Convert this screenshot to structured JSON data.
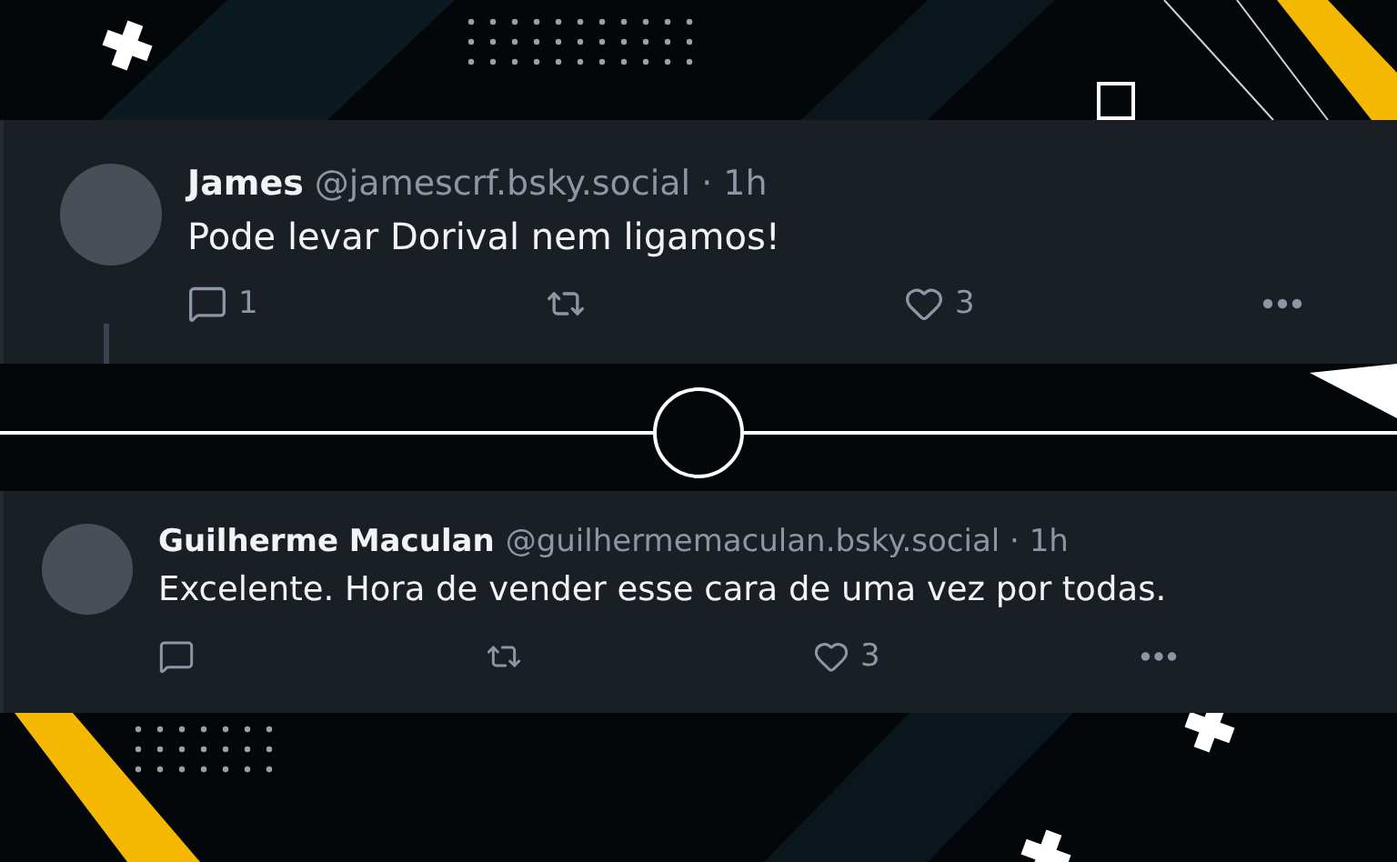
{
  "posts": [
    {
      "author": "James",
      "meta": "@jamescrf.bsky.social · 1h",
      "text": "Pode levar Dorival nem ligamos!",
      "replies": "1",
      "likes": "3",
      "thread_line": true
    },
    {
      "author": "Guilherme Maculan",
      "meta": "@guilhermemaculan.bsky.social · 1h",
      "text": "Excelente. Hora de vender esse cara de uma vez por todas.",
      "likes": "3",
      "thread_line": false
    }
  ]
}
